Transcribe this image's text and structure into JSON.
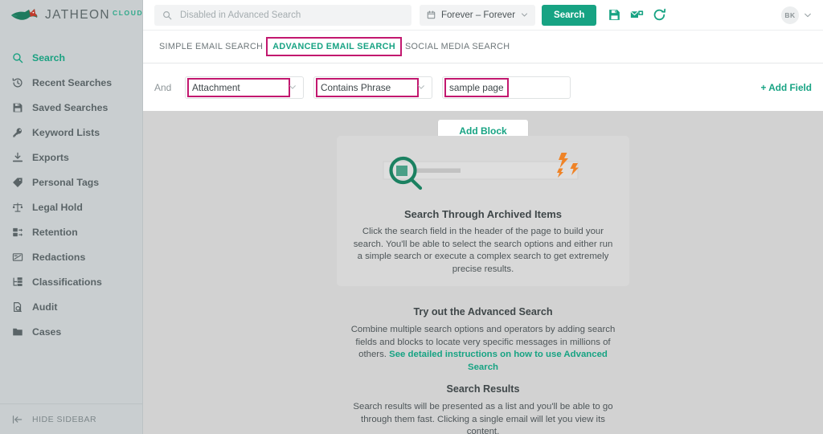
{
  "brand": {
    "name": "JATHEON",
    "suffix": "CLOUD",
    "accent": "#17a383",
    "highlight": "#c2186f"
  },
  "sidebar": {
    "items": [
      {
        "label": "Search",
        "icon": "search-icon",
        "active": true
      },
      {
        "label": "Recent Searches",
        "icon": "history-icon",
        "active": false
      },
      {
        "label": "Saved Searches",
        "icon": "save-icon",
        "active": false
      },
      {
        "label": "Keyword Lists",
        "icon": "key-icon",
        "active": false
      },
      {
        "label": "Exports",
        "icon": "download-icon",
        "active": false
      },
      {
        "label": "Personal Tags",
        "icon": "tag-icon",
        "active": false
      },
      {
        "label": "Legal Hold",
        "icon": "scales-icon",
        "active": false
      },
      {
        "label": "Retention",
        "icon": "retention-icon",
        "active": false
      },
      {
        "label": "Redactions",
        "icon": "redaction-icon",
        "active": false
      },
      {
        "label": "Classifications",
        "icon": "classification-icon",
        "active": false
      },
      {
        "label": "Audit",
        "icon": "audit-icon",
        "active": false
      },
      {
        "label": "Cases",
        "icon": "folder-icon",
        "active": false
      }
    ],
    "hide_sidebar_label": "HIDE SIDEBAR"
  },
  "header": {
    "search_placeholder": "Disabled in Advanced Search",
    "search_value": "",
    "date_range": "Forever – Forever",
    "search_button": "Search",
    "icons": [
      "save-search-icon",
      "save-as-search-icon",
      "reset-search-icon"
    ],
    "avatar_initials": "BK"
  },
  "tabs": [
    {
      "label": "SIMPLE EMAIL SEARCH",
      "active": false,
      "highlighted": false
    },
    {
      "label": "ADVANCED EMAIL SEARCH",
      "active": true,
      "highlighted": true
    },
    {
      "label": "SOCIAL MEDIA SEARCH",
      "active": false,
      "highlighted": false
    }
  ],
  "query": {
    "conjunction": "And",
    "field_select": "Attachment",
    "operator_select": "Contains Phrase",
    "value_input": "sample page",
    "value_placeholder": "",
    "add_field_label": "+ Add Field"
  },
  "content": {
    "add_block_label": "Add Block",
    "card": {
      "title": "Search Through Archived Items",
      "body": "Click the search field in the header of the page to build your search. You'll be able to select the search options and either run a simple search or execute a complex search to get extremely precise results."
    },
    "sections": [
      {
        "title": "Try out the Advanced Search",
        "body": "Combine multiple search options and operators by adding search fields and blocks to locate very specific messages in millions of others. ",
        "link": "See detailed instructions on how to use Advanced Search"
      },
      {
        "title": "Search Results",
        "body": "Search results will be presented as a list and you'll be able to go through them fast. Clicking a single email will let you view its content.",
        "link": ""
      }
    ]
  }
}
